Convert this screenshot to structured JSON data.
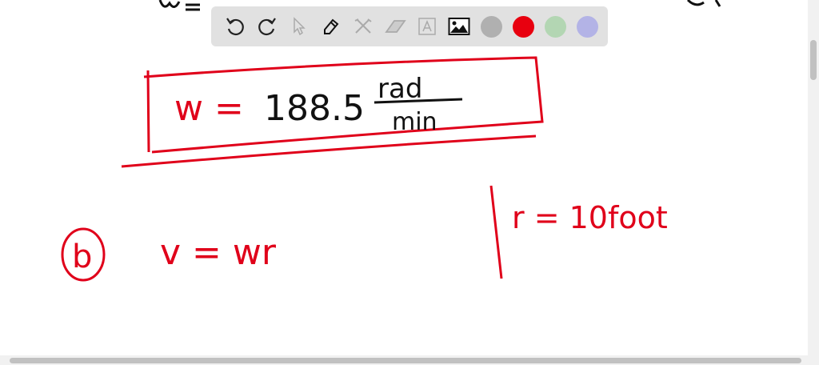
{
  "toolbar": {
    "tools": [
      "undo",
      "redo",
      "select",
      "pen",
      "tools",
      "eraser",
      "text",
      "image"
    ],
    "colors": [
      "#b0b0b0",
      "#e8000f",
      "#b3d6b3",
      "#b3b3e6"
    ],
    "selected_color": "#e8000f"
  },
  "board": {
    "omega_lhs": "w =",
    "omega_value": "188.5",
    "omega_unit_num": "rad",
    "omega_unit_den": "min",
    "part_label": "b",
    "velocity_eq": "v = wr",
    "radius_eq": "r = 10foot",
    "ink_color": "#e0001a"
  }
}
